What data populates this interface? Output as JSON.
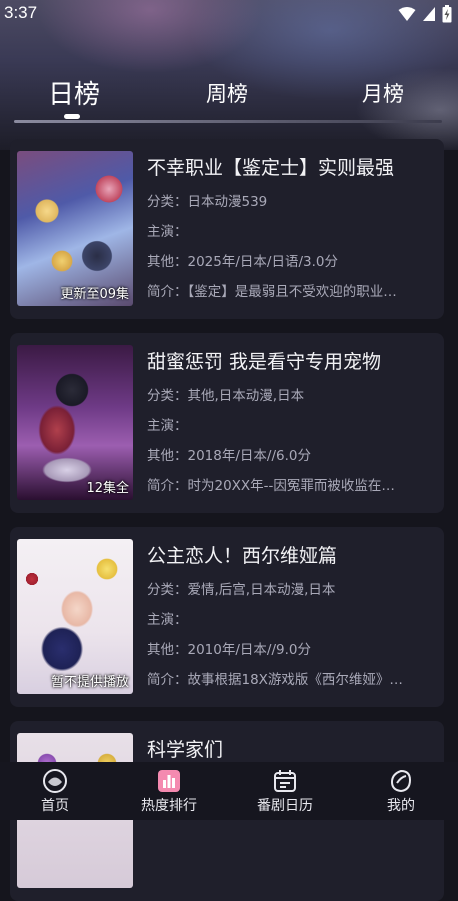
{
  "status_bar": {
    "time": "3:37"
  },
  "tabs": [
    {
      "label": "日榜",
      "active": true
    },
    {
      "label": "周榜",
      "active": false
    },
    {
      "label": "月榜",
      "active": false
    }
  ],
  "items": [
    {
      "title": "不幸职业【鉴定士】实则最强",
      "category": "分类：日本动漫539",
      "cast": "主演：",
      "other": "其他：2025年/日本/日语/3.0分",
      "intro": "简介：【鉴定】是最弱且不受欢迎的职业…",
      "badge": "更新至09集"
    },
    {
      "title": "甜蜜惩罚 我是看守专用宠物",
      "category": "分类：其他,日本动漫,日本",
      "cast": "主演：",
      "other": "其他：2018年/日本//6.0分",
      "intro": "简介：时为20XX年--因冤罪而被收监在…",
      "badge": "12集全"
    },
    {
      "title": "公主恋人！西尔维娅篇",
      "category": "分类：爱情,后宫,日本动漫,日本",
      "cast": "主演：",
      "other": "其他：2010年/日本//9.0分",
      "intro": "简介：故事根据18X游戏版《西尔维娅》…",
      "badge": "暂不提供播放"
    },
    {
      "title": "科学家们"
    }
  ],
  "bottom_nav": [
    {
      "label": "首页",
      "icon": "home-icon"
    },
    {
      "label": "热度排行",
      "icon": "ranking-icon"
    },
    {
      "label": "番剧日历",
      "icon": "calendar-icon"
    },
    {
      "label": "我的",
      "icon": "profile-icon"
    }
  ]
}
